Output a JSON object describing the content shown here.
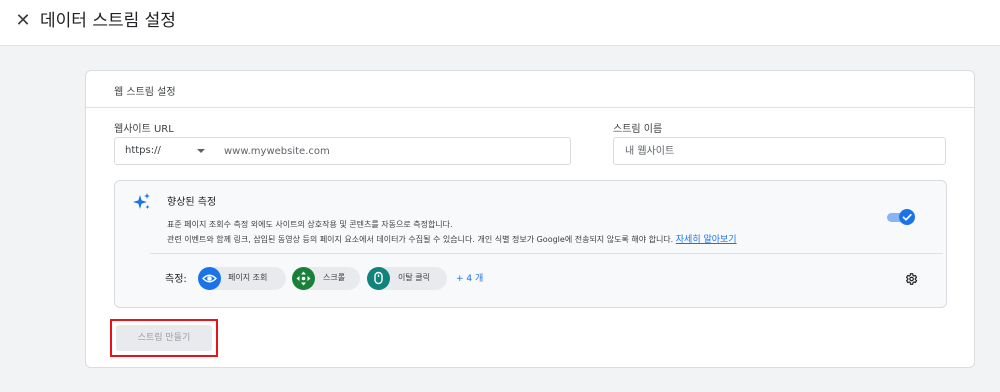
{
  "header": {
    "close_glyph": "✕",
    "title": "데이터 스트림 설정"
  },
  "card": {
    "title": "웹 스트림 설정",
    "url_label": "웹사이트 URL",
    "protocol": "https://",
    "url_placeholder": "www.mywebsite.com",
    "name_label": "스트림 이름",
    "name_placeholder": "내 웹사이트"
  },
  "enhanced": {
    "title": "향상된 측정",
    "desc_line1": "표준 페이지 조회수 측정 외에도 사이트의 상호작용 및 콘텐츠를 자동으로 측정합니다.",
    "desc_line2": "관련 이벤트와 함께 링크, 삽입된 동영상 등의 페이지 요소에서 데이터가 수집될 수 있습니다. 개인 식별 정보가 Google에 전송되지 않도록 해야 합니다.",
    "learn_more": "자세히 알아보기",
    "toggle_on": true,
    "measure_label": "측정:",
    "chips": [
      {
        "label": "페이지 조회",
        "icon": "eye-icon",
        "color": "#1a73e8"
      },
      {
        "label": "스크롤",
        "icon": "scroll-arrows-icon",
        "color": "#188038"
      },
      {
        "label": "이탈 클릭",
        "icon": "mouse-icon",
        "color": "#12827d"
      }
    ],
    "more": "+ 4 개"
  },
  "create_button": "스트림 만들기",
  "colors": {
    "accent": "#1a73e8",
    "highlight": "#e8141b"
  }
}
